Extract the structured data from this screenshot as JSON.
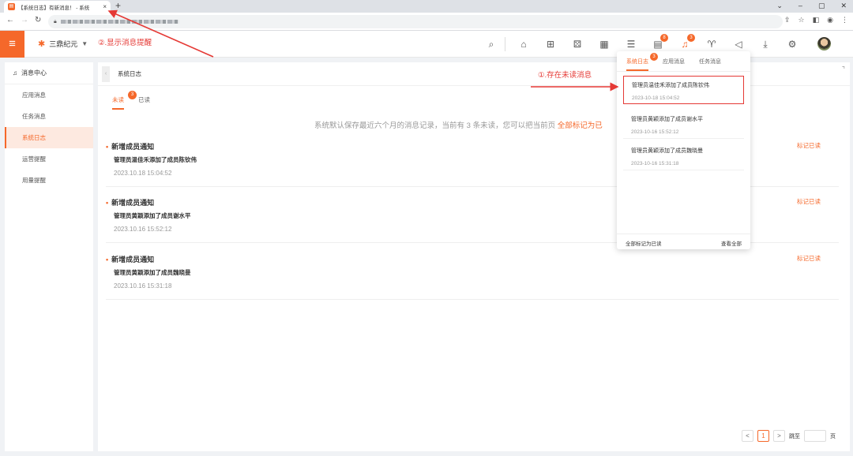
{
  "browser": {
    "tab_title": "【系统日志】有新消息！ - 系统",
    "tab_close": "×",
    "new_tab": "+",
    "win_controls": [
      "⌄",
      "–",
      "▢",
      "✕"
    ]
  },
  "app": {
    "brand": "三鼎纪元",
    "accent": "#f5682a"
  },
  "header_icons": [
    {
      "name": "search-icon",
      "glyph": "⌕"
    },
    {
      "name": "home-icon",
      "glyph": "⌂"
    },
    {
      "name": "grid-icon",
      "glyph": "⊞"
    },
    {
      "name": "dice-icon",
      "glyph": "⚄"
    },
    {
      "name": "apps-icon",
      "glyph": "▦"
    },
    {
      "name": "list-icon",
      "glyph": "☰"
    },
    {
      "name": "task-icon",
      "glyph": "▤",
      "badge": "8"
    },
    {
      "name": "bell-icon",
      "glyph": "♫",
      "badge": "3"
    },
    {
      "name": "shirt-icon",
      "glyph": "♈"
    },
    {
      "name": "megaphone-icon",
      "glyph": "◁"
    },
    {
      "name": "download-icon",
      "glyph": "⤓"
    },
    {
      "name": "settings-icon",
      "glyph": "⚙"
    }
  ],
  "sidebar": {
    "title": "消息中心",
    "items": [
      "应用消息",
      "任务消息",
      "系统日志",
      "运营提醒",
      "用量提醒"
    ]
  },
  "main": {
    "breadcrumb": "系统日志",
    "tabs": [
      {
        "label": "未读",
        "badge": "3"
      },
      {
        "label": "已读"
      }
    ],
    "notice_text": "系统默认保存最近六个月的消息记录，当前有 3 条未读，您可以把当前页 ",
    "notice_link": "全部标记为已",
    "messages": [
      {
        "title": "新增成员通知",
        "body": "管理员温佳禾添加了成员陈钦伟",
        "time": "2023.10.18 15:04:52",
        "action": "标记已读"
      },
      {
        "title": "新增成员通知",
        "body": "管理员黄颖添加了成员谢水平",
        "time": "2023.10.16 15:52:12",
        "action": "标记已读"
      },
      {
        "title": "新增成员通知",
        "body": "管理员黄颖添加了成员魏晓曼",
        "time": "2023.10.16 15:31:18",
        "action": "标记已读"
      }
    ],
    "pager": {
      "prev": "<",
      "current": "1",
      "next": ">",
      "goto_label": "跳至",
      "page_suffix": "页"
    }
  },
  "panel": {
    "tabs": [
      {
        "label": "系统日志",
        "badge": "3"
      },
      {
        "label": "应用消息"
      },
      {
        "label": "任务消息"
      }
    ],
    "items": [
      {
        "text": "管理员温佳禾添加了成员陈钦伟",
        "time": "2023-10-18 15:04:52"
      },
      {
        "text": "管理员黄颖添加了成员谢水平",
        "time": "2023-10-16 15:52:12"
      },
      {
        "text": "管理员黄颖添加了成员魏晓曼",
        "time": "2023-10-16 15:31:18"
      }
    ],
    "mark_all": "全部标记为已读",
    "view_all": "查看全部"
  },
  "annotations": {
    "unread": "①.存在未读消息",
    "title_hint": "②.显示消息提醒",
    "color": "#e53935"
  }
}
